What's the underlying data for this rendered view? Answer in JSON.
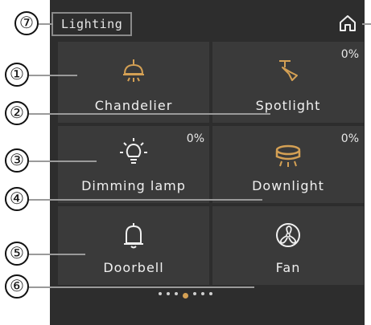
{
  "header": {
    "title": "Lighting"
  },
  "devices": [
    {
      "name": "Chandelier",
      "icon": "chandelier-icon",
      "percent": ""
    },
    {
      "name": "Spotlight",
      "icon": "spotlight-icon",
      "percent": "0%"
    },
    {
      "name": "Dimming lamp",
      "icon": "dimming-lamp-icon",
      "percent": "0%"
    },
    {
      "name": "Downlight",
      "icon": "downlight-icon",
      "percent": "0%"
    },
    {
      "name": "Doorbell",
      "icon": "doorbell-icon",
      "percent": ""
    },
    {
      "name": "Fan",
      "icon": "fan-icon",
      "percent": ""
    }
  ],
  "callouts": [
    "①",
    "②",
    "③",
    "④",
    "⑤",
    "⑥",
    "⑦"
  ],
  "pagination": {
    "pages": 7,
    "active_page": 3
  },
  "colors": {
    "accent": "#d4a054",
    "background": "#2d2d2d",
    "tile": "#3a3a3a"
  }
}
